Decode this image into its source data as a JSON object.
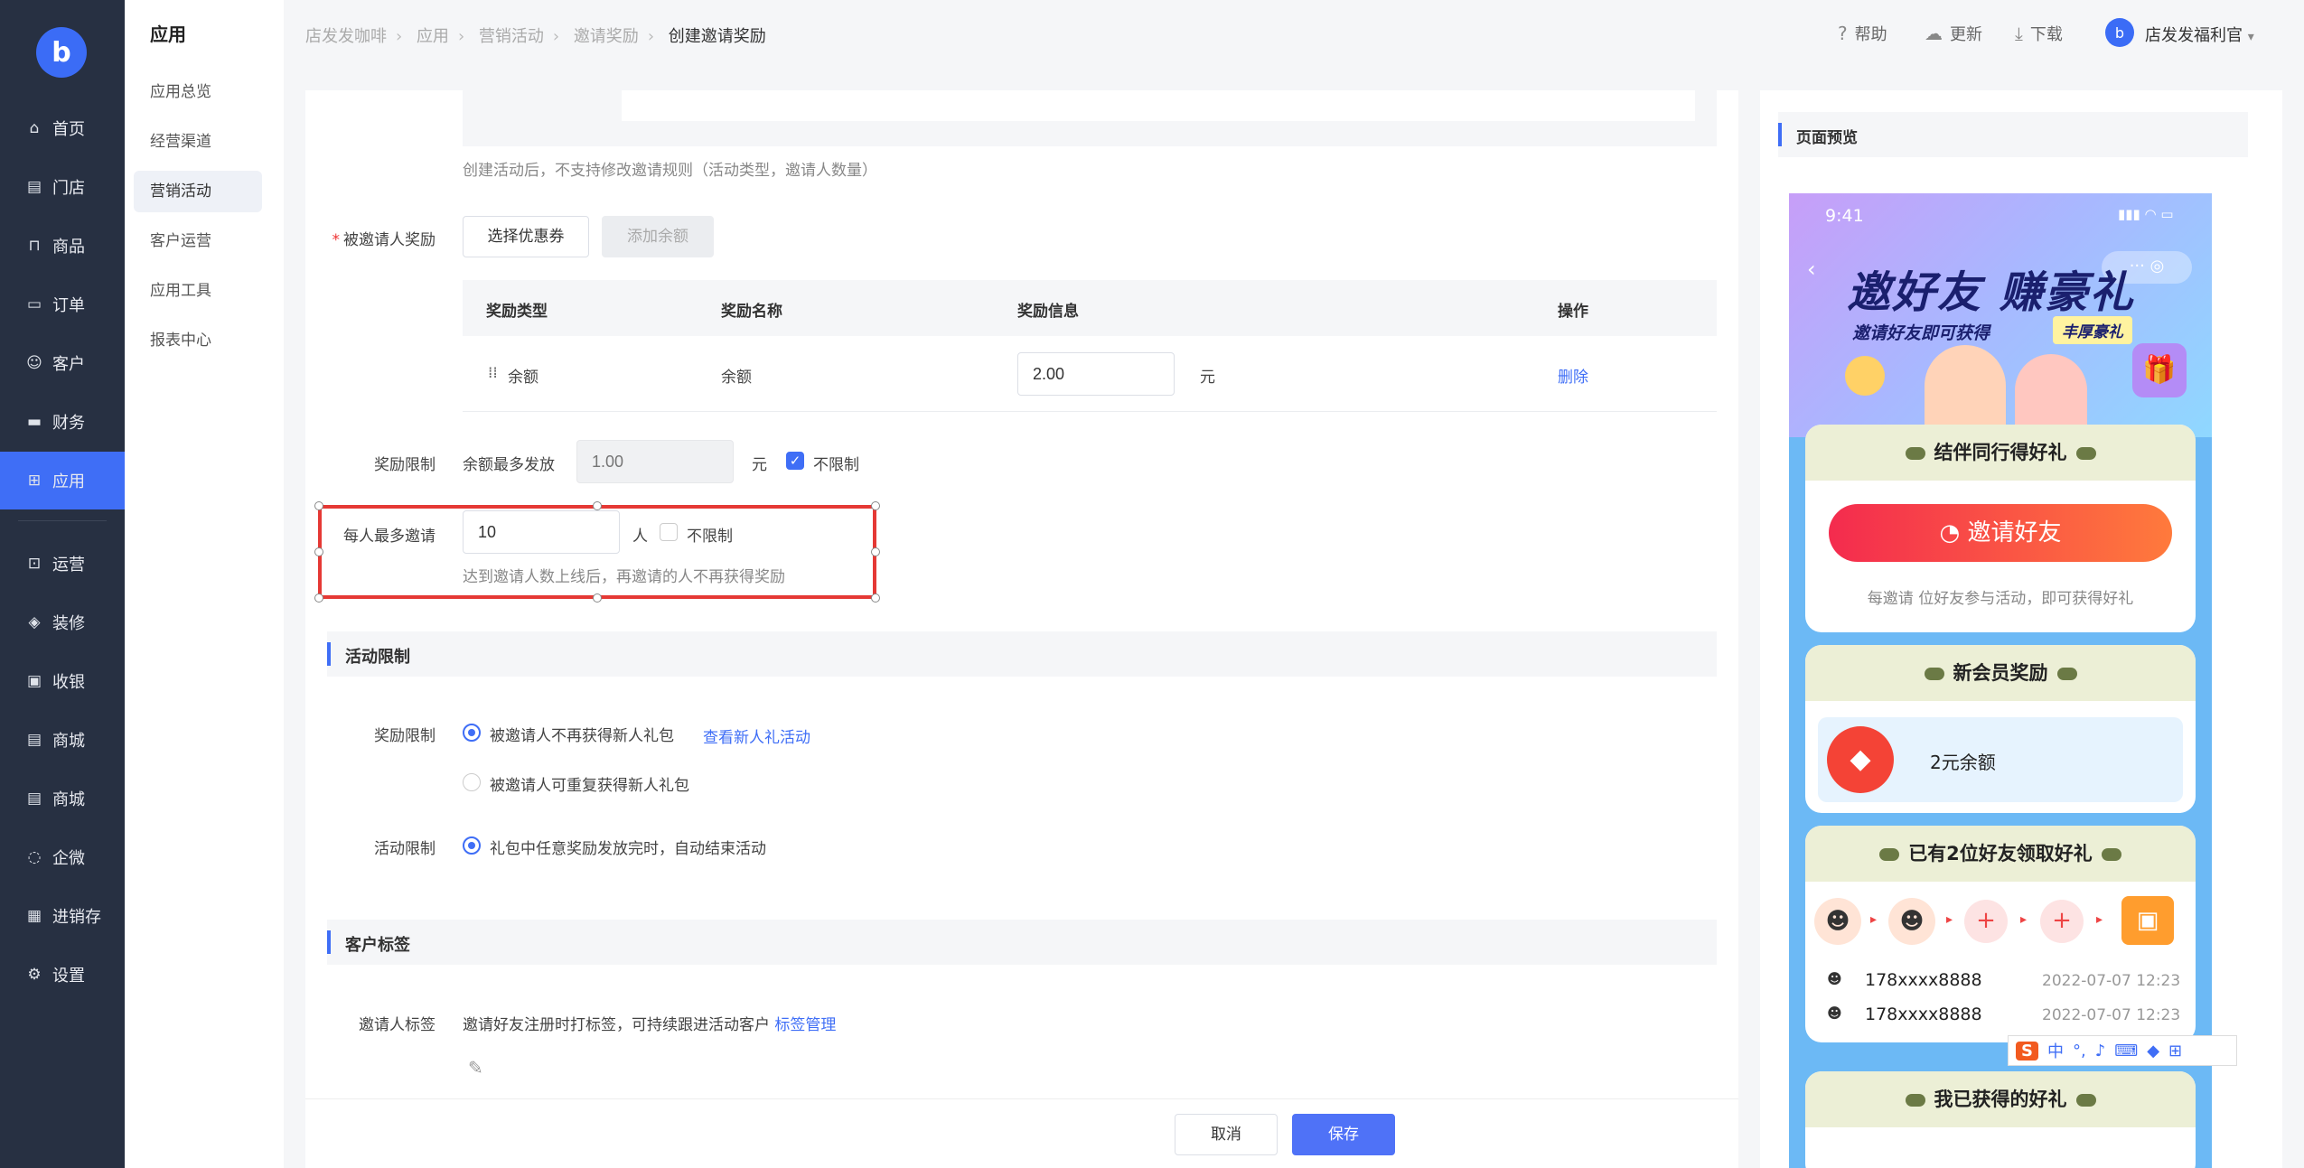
{
  "nav": {
    "logo_glyph": "b",
    "items": [
      {
        "label": "首页",
        "icon": "home-icon"
      },
      {
        "label": "门店",
        "icon": "store-icon"
      },
      {
        "label": "商品",
        "icon": "bag-icon"
      },
      {
        "label": "订单",
        "icon": "order-icon"
      },
      {
        "label": "客户",
        "icon": "user-icon"
      },
      {
        "label": "财务",
        "icon": "wallet-icon"
      },
      {
        "label": "应用",
        "icon": "grid-icon"
      },
      {
        "label": "运营",
        "icon": "gift-icon"
      },
      {
        "label": "装修",
        "icon": "layers-icon"
      },
      {
        "label": "收银",
        "icon": "cashier-icon"
      },
      {
        "label": "商城",
        "icon": "mall-icon"
      },
      {
        "label": "商城",
        "icon": "mall-icon"
      },
      {
        "label": "企微",
        "icon": "chat-icon"
      },
      {
        "label": "进销存",
        "icon": "inventory-icon"
      },
      {
        "label": "设置",
        "icon": "settings-icon"
      }
    ]
  },
  "sub": {
    "title": "应用",
    "items": [
      "应用总览",
      "经营渠道",
      "营销活动",
      "客户运营",
      "应用工具",
      "报表中心"
    ]
  },
  "header": {
    "crumbs": [
      "店发发咖啡",
      "应用",
      "营销活动",
      "邀请奖励"
    ],
    "current": "创建邀请奖励",
    "help": "帮助",
    "update": "更新",
    "download": "下载",
    "user": "店发发福利官",
    "avatar_glyph": "b"
  },
  "form": {
    "rule_tip": "创建活动后，不支持修改邀请规则（活动类型，邀请人数量）",
    "invitee_reward": {
      "label": "被邀请人奖励",
      "select_coupon": "选择优惠券",
      "add_balance": "添加余额"
    },
    "table": {
      "headers": [
        "奖励类型",
        "奖励名称",
        "奖励信息",
        "操作"
      ],
      "row": {
        "type": "余额",
        "name": "余额",
        "value": "2.00",
        "unit": "元",
        "action": "删除",
        "drag": "⁞⁞"
      }
    },
    "reward_limit": {
      "label": "奖励限制",
      "text": "余额最多发放",
      "placeholder": "1.00",
      "unit": "元",
      "unlimited": "不限制"
    },
    "max_invite": {
      "label": "每人最多邀请",
      "value": "10",
      "unit": "人",
      "unlimited": "不限制",
      "tip": "达到邀请人数上线后，再邀请的人不再获得奖励"
    },
    "activity_limit_section": "活动限制",
    "activity_reward_limit": {
      "label": "奖励限制",
      "opt1": "被邀请人不再获得新人礼包",
      "opt1_link": "查看新人礼活动",
      "opt2": "被邀请人可重复获得新人礼包"
    },
    "activity_limit": {
      "label": "活动限制",
      "opt1": "礼包中任意奖励发放完时，自动结束活动"
    },
    "customer_tag_section": "客户标签",
    "inviter_tag": {
      "label": "邀请人标签",
      "text": "邀请好友注册时打标签，可持续跟进活动客户",
      "link": "标签管理"
    }
  },
  "footer": {
    "cancel": "取消",
    "save": "保存"
  },
  "preview": {
    "title": "页面预览",
    "time": "9:41",
    "hero_title": "邀好友 赚豪礼",
    "hero_sub": "邀请好友即可获得",
    "hero_badge": "丰厚豪礼",
    "card1": {
      "title": "结伴同行得好礼",
      "button": "邀请好友",
      "tip": "每邀请 位好友参与活动，即可获得好礼"
    },
    "card2": {
      "title": "新会员奖励",
      "item": "2元余额"
    },
    "card3": {
      "title": "已有2位好友领取好礼",
      "records": [
        {
          "phone": "178xxxx8888",
          "time": "2022-07-07 12:23"
        },
        {
          "phone": "178xxxx8888",
          "time": "2022-07-07 12:23"
        }
      ]
    },
    "card4": {
      "title": "我已获得的好礼"
    }
  },
  "ime": {
    "glyph": "S",
    "lang": "中"
  },
  "colors": {
    "primary": "#3f6ef6",
    "nav_bg": "#273042",
    "highlight": "#e53935"
  }
}
